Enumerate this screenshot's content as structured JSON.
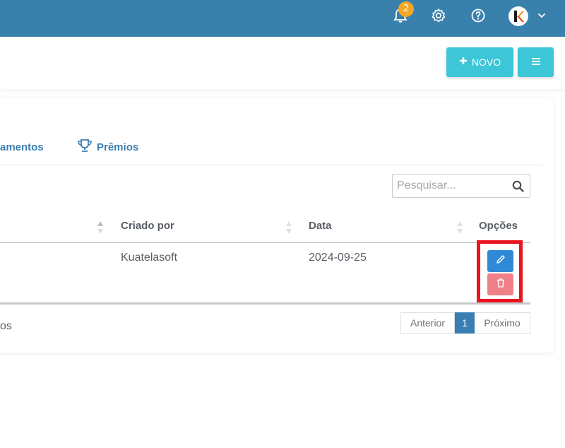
{
  "topbar": {
    "notification_count": "2",
    "icons": [
      "bell-icon",
      "gear-icon",
      "help-icon",
      "user-avatar",
      "chevron-down-icon"
    ],
    "color": "#3a80ad"
  },
  "toolbar": {
    "new_label": "NOVO",
    "new_icon": "plus-icon",
    "menu_icon": "menu-icon",
    "accent": "#3dc6d8"
  },
  "tabs": [
    {
      "label": "amentos"
    },
    {
      "label": "Prêmios",
      "icon": "trophy-icon"
    }
  ],
  "search": {
    "placeholder": "Pesquisar..."
  },
  "table": {
    "columns": [
      "Criado por",
      "Data",
      "Opções"
    ],
    "rows": [
      {
        "criado_por": "Kuatelasoft",
        "data": "2024-09-25"
      }
    ]
  },
  "footer": {
    "info": "os"
  },
  "pagination": {
    "prev": "Anterior",
    "current": "1",
    "next": "Próximo"
  }
}
